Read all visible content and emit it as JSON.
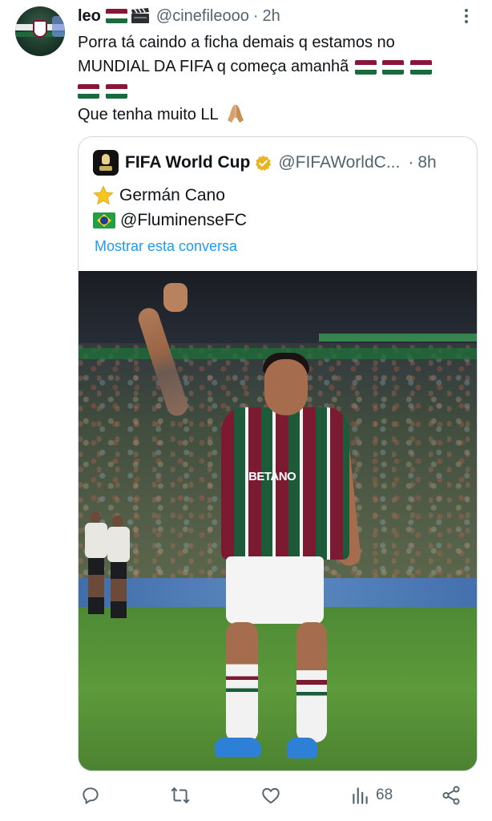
{
  "tweet": {
    "author_name": "leo",
    "author_handle": "@cinefileooo",
    "separator": "·",
    "time": "2h",
    "text_line1": "Porra tá caindo a ficha demais q estamos no",
    "text_line2": "MUNDIAL DA FIFA q começa amanhã",
    "text_line4": "Que tenha muito LL",
    "icons": {
      "more": "more-vertical-icon",
      "flag": "fluminense-flag-icon",
      "clapper": "clapperboard-icon",
      "pray": "folded-hands-icon"
    }
  },
  "quote": {
    "author_name": "FIFA World Cup",
    "author_handle": "@FIFAWorldC...",
    "separator": "·",
    "time": "8h",
    "line1": "Germán Cano",
    "line2": "@FluminenseFC",
    "show_thread": "Mostrar esta conversa",
    "photo": {
      "sponsor": "BETANO",
      "description_icon": "player-celebration-photo"
    },
    "colors": {
      "link": "#1d9bf0",
      "verified": "#e8b422"
    }
  },
  "actions": {
    "reply": {
      "icon": "reply-icon"
    },
    "retweet": {
      "icon": "retweet-icon"
    },
    "like": {
      "icon": "heart-icon"
    },
    "views": {
      "icon": "views-icon",
      "count": "68"
    },
    "share": {
      "icon": "share-icon"
    }
  },
  "colors": {
    "text": "#0f1419",
    "muted": "#536471",
    "border": "#cfd9de",
    "flag_red": "#8a1538",
    "flag_white": "#ffffff",
    "flag_green": "#1a6b3c"
  }
}
